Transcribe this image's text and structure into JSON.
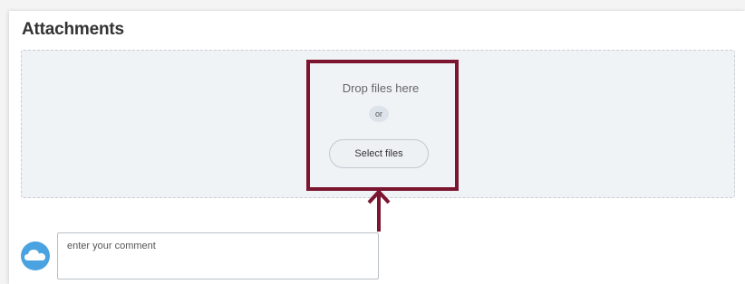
{
  "section": {
    "title": "Attachments"
  },
  "dropzone": {
    "drop_text": "Drop files here",
    "or_text": "or",
    "select_label": "Select files"
  },
  "annotation": {
    "color": "#7b1530"
  },
  "comment": {
    "avatar_icon": "cloud-icon",
    "placeholder": "enter your comment",
    "value": ""
  }
}
